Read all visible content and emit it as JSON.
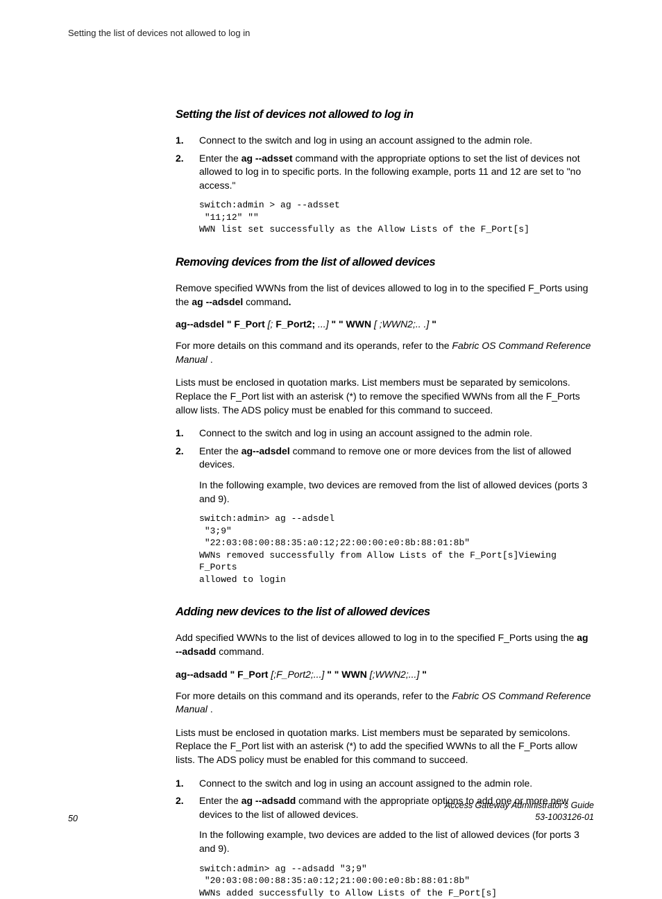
{
  "header": "Setting the list of devices not allowed to log in",
  "section1": {
    "title": "Setting the list of devices not allowed to log in",
    "step1": "Connect to the switch and log in using an account assigned to the admin role.",
    "step2a": "Enter the ",
    "step2b": "ag --adsset",
    "step2c": " command with the appropriate options to set the list of devices not allowed to log in to specific ports. In the following example, ports 11 and 12 are set to \"no access.\"",
    "code": "switch:admin > ag --adsset\n \"11;12\" \"\"\nWWN list set successfully as the Allow Lists of the F_Port[s]"
  },
  "section2": {
    "title": "Removing devices from the list of allowed devices",
    "intro1": "Remove specified WWNs from the list of devices allowed to log in to the specified F_Ports using the ",
    "intro2": "ag --adsdel",
    "intro3": " command",
    "intro4": ".",
    "syntax1": "ag--adsdel \" F_Port ",
    "syntax2": "[; ",
    "syntax3": "F_Port2; ",
    "syntax4": "...] ",
    "syntax5": "\" \" WWN ",
    "syntax6": "[ ;WWN2;.. .] ",
    "syntax7": "\"",
    "details1": "For more details on this command and its operands, refer to the ",
    "details2": "Fabric OS Command Reference Manual ",
    "details3": ".",
    "lists": "Lists must be enclosed in quotation marks. List members must be separated by semicolons. Replace the F_Port list with an asterisk (*) to remove the specified WWNs from all the F_Ports allow lists. The ADS policy must be enabled for this command to succeed.",
    "step1": "Connect to the switch and log in using an account assigned to the admin role.",
    "step2a": "Enter the ",
    "step2b": "ag--adsdel",
    "step2c": " command to remove one or more devices from the list of allowed devices.",
    "step2sub": "In the following example, two devices are removed from the list of allowed devices (ports 3 and 9).",
    "code": "switch:admin> ag --adsdel\n \"3;9\"\n \"22:03:08:00:88:35:a0:12;22:00:00:e0:8b:88:01:8b\"\nWWNs removed successfully from Allow Lists of the F_Port[s]Viewing F_Ports\nallowed to login"
  },
  "section3": {
    "title": "Adding new devices to the list of allowed devices",
    "intro1": "Add specified WWNs to the list of devices allowed to log in to the specified F_Ports using the ",
    "intro2": "ag --adsadd",
    "intro3": " command.",
    "syntax1": "ag--adsadd \" F_Port ",
    "syntax2": "[;F_Port2;...] ",
    "syntax3": "\" \" WWN ",
    "syntax4": "[;WWN2;...] ",
    "syntax5": "\"",
    "details1": "For more details on this command and its operands, refer to the ",
    "details2": "Fabric OS Command Reference Manual ",
    "details3": ".",
    "lists": "Lists must be enclosed in quotation marks. List members must be separated by semicolons. Replace the F_Port list with an asterisk (*) to add the specified WWNs to all the F_Ports allow lists. The ADS policy must be enabled for this command to succeed.",
    "step1": "Connect to the switch and log in using an account assigned to the admin role.",
    "step2a": "Enter the ",
    "step2b": "ag --adsadd",
    "step2c": " command with the appropriate options to add one or more new devices to the list of allowed devices.",
    "step2sub": "In the following example, two devices are added to the list of allowed devices (for ports 3 and 9).",
    "code": "switch:admin> ag --adsadd \"3;9\"\n \"20:03:08:00:88:35:a0:12;21:00:00:e0:8b:88:01:8b\"\nWWNs added successfully to Allow Lists of the F_Port[s]"
  },
  "footer": {
    "page": "50",
    "guide": "Access Gateway Administrator's Guide",
    "docnum": "53-1003126-01"
  }
}
